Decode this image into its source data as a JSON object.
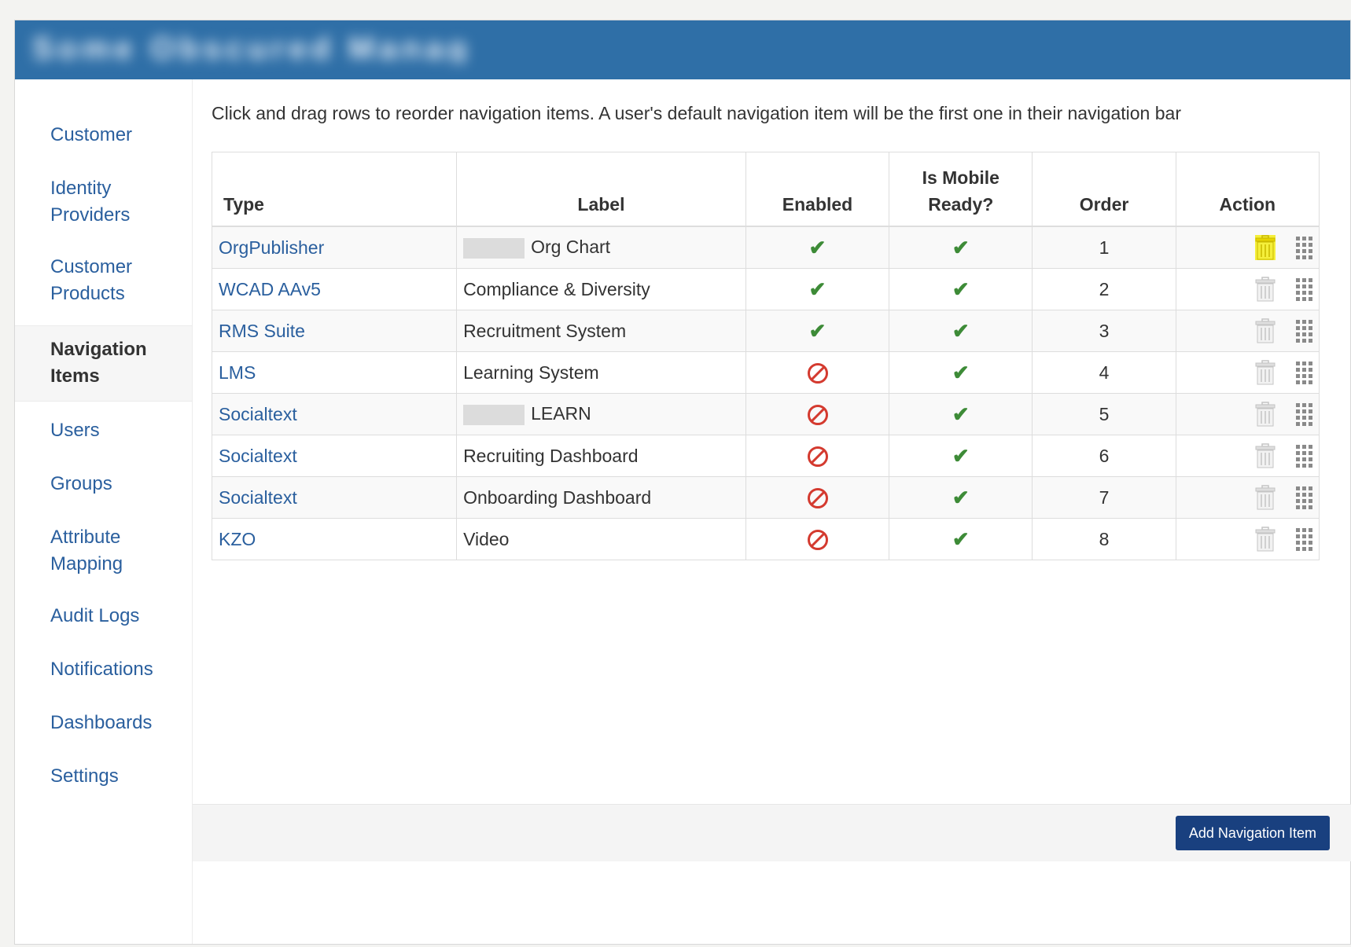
{
  "header": {
    "title": "Some Obscured Manager"
  },
  "sidebar": {
    "items": [
      {
        "label": "Customer"
      },
      {
        "label": "Identity Providers"
      },
      {
        "label": "Customer Products"
      },
      {
        "label": "Navigation Items"
      },
      {
        "label": "Users"
      },
      {
        "label": "Groups"
      },
      {
        "label": "Attribute Mapping"
      },
      {
        "label": "Audit Logs"
      },
      {
        "label": "Notifications"
      },
      {
        "label": "Dashboards"
      },
      {
        "label": "Settings"
      }
    ]
  },
  "main": {
    "instructions": "Click and drag rows to reorder navigation items. A user's default navigation item will be the first one in their navigation bar",
    "columns": {
      "type": "Type",
      "label": "Label",
      "enabled": "Enabled",
      "mobile": "Is Mobile Ready?",
      "order": "Order",
      "action": "Action"
    },
    "rows": [
      {
        "type": "OrgPublisher",
        "label": "Org Chart",
        "label_redacted": true,
        "enabled": true,
        "mobile": true,
        "order": "1"
      },
      {
        "type": "WCAD AAv5",
        "label": "Compliance & Diversity",
        "label_redacted": false,
        "enabled": true,
        "mobile": true,
        "order": "2"
      },
      {
        "type": "RMS Suite",
        "label": "Recruitment System",
        "label_redacted": false,
        "enabled": true,
        "mobile": true,
        "order": "3"
      },
      {
        "type": "LMS",
        "label": "Learning System",
        "label_redacted": false,
        "enabled": false,
        "mobile": true,
        "order": "4"
      },
      {
        "type": "Socialtext",
        "label": "LEARN",
        "label_redacted": true,
        "enabled": false,
        "mobile": true,
        "order": "5"
      },
      {
        "type": "Socialtext",
        "label": "Recruiting Dashboard",
        "label_redacted": false,
        "enabled": false,
        "mobile": true,
        "order": "6"
      },
      {
        "type": "Socialtext",
        "label": "Onboarding Dashboard",
        "label_redacted": false,
        "enabled": false,
        "mobile": true,
        "order": "7"
      },
      {
        "type": "KZO",
        "label": "Video",
        "label_redacted": false,
        "enabled": false,
        "mobile": true,
        "order": "8"
      }
    ],
    "icons": {
      "enabled_true": "check-icon",
      "enabled_false": "no-entry-icon",
      "delete": "trash-icon",
      "drag": "drag-handle-icon"
    },
    "add_button": "Add Navigation Item"
  },
  "colors": {
    "header": "#2f6fa7",
    "link": "#2a5f9e",
    "check": "#3d8b37",
    "no_entry": "#d43a2f",
    "button": "#19407f",
    "highlight": "#f5ef3b"
  }
}
